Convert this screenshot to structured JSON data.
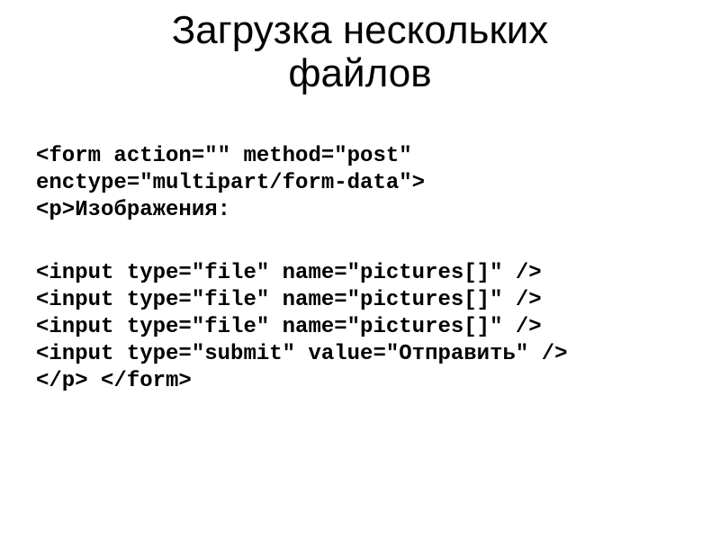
{
  "title_line1": "Загрузка нескольких",
  "title_line2": "файлов",
  "code": {
    "l1": "<form action=\"\" method=\"post\"",
    "l2": "enctype=\"multipart/form-data\">",
    "l3": "<p>Изображения:",
    "l4": "<input type=\"file\" name=\"pictures[]\" />",
    "l5": "<input type=\"file\" name=\"pictures[]\" />",
    "l6": "<input type=\"file\" name=\"pictures[]\" />",
    "l7": "<input type=\"submit\" value=\"Отправить\" />",
    "l8": "</p> </form>"
  }
}
